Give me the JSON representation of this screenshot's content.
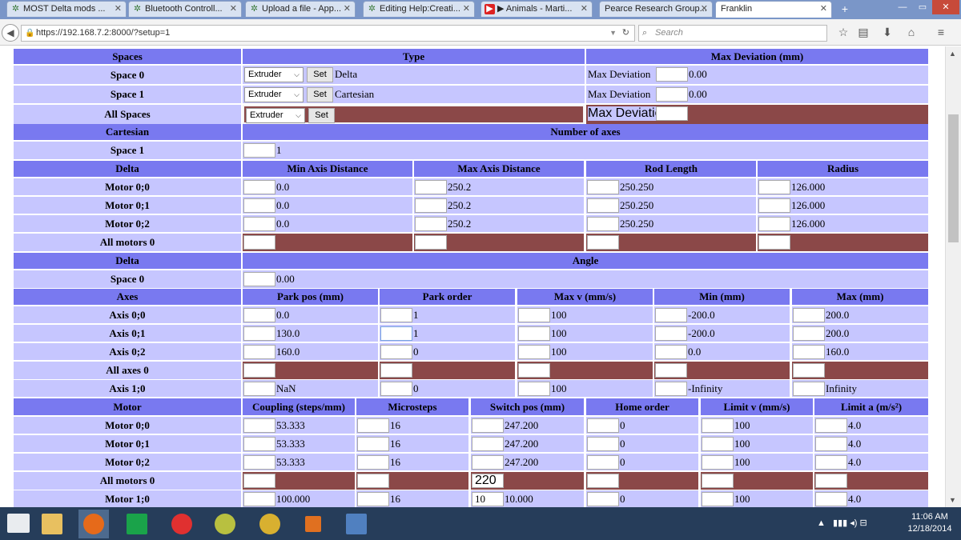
{
  "browser": {
    "tabs": [
      {
        "label": "MOST Delta mods ...",
        "icon": "asterisk-icon"
      },
      {
        "label": "Bluetooth Controll...",
        "icon": "asterisk-icon"
      },
      {
        "label": "Upload a file - App...",
        "icon": "asterisk-icon"
      },
      {
        "label": "Editing Help:Creati...",
        "icon": "asterisk-icon"
      },
      {
        "label": "▶ Animals - Marti...",
        "icon": "youtube-icon"
      },
      {
        "label": "Pearce Research Group...",
        "icon": ""
      },
      {
        "label": "Franklin",
        "icon": ""
      }
    ],
    "url": "https://192.168.7.2:8000/?setup=1",
    "search_placeholder": "Search"
  },
  "spaces": {
    "headers": [
      "Spaces",
      "Type",
      "Max Deviation (mm)"
    ],
    "rows": [
      {
        "label": "Space 0",
        "type": "Extruder",
        "set": "Set",
        "type_value": "Delta",
        "maxdev_label": "Max Deviation",
        "maxdev": "0.00"
      },
      {
        "label": "Space 1",
        "type": "Extruder",
        "set": "Set",
        "type_value": "Cartesian",
        "maxdev_label": "Max Deviation",
        "maxdev": "0.00"
      },
      {
        "label": "All Spaces",
        "type": "Extruder",
        "set": "Set",
        "type_value": "",
        "maxdev_label": "Max Deviation",
        "maxdev": ""
      }
    ]
  },
  "cartesian": {
    "headers": [
      "Cartesian",
      "Number of axes"
    ],
    "rows": [
      {
        "label": "Space 1",
        "value": "1"
      }
    ]
  },
  "delta": {
    "headers": [
      "Delta",
      "Min Axis Distance",
      "Max Axis Distance",
      "Rod Length",
      "Radius"
    ],
    "rows": [
      {
        "label": "Motor 0;0",
        "values": [
          "0.0",
          "250.2",
          "250.250",
          "126.000"
        ]
      },
      {
        "label": "Motor 0;1",
        "values": [
          "0.0",
          "250.2",
          "250.250",
          "126.000"
        ]
      },
      {
        "label": "Motor 0;2",
        "values": [
          "0.0",
          "250.2",
          "250.250",
          "126.000"
        ]
      },
      {
        "label": "All motors 0",
        "values": [
          "",
          "",
          "",
          ""
        ]
      }
    ]
  },
  "delta_angle": {
    "headers": [
      "Delta",
      "Angle"
    ],
    "rows": [
      {
        "label": "Space 0",
        "value": "0.00"
      }
    ]
  },
  "axes": {
    "headers": [
      "Axes",
      "Park pos (mm)",
      "Park order",
      "Max v (mm/s)",
      "Min (mm)",
      "Max (mm)"
    ],
    "rows": [
      {
        "label": "Axis 0;0",
        "values": [
          "0.0",
          "1",
          "100",
          "-200.0",
          "200.0"
        ]
      },
      {
        "label": "Axis 0;1",
        "values": [
          "130.0",
          "1",
          "100",
          "-200.0",
          "200.0"
        ]
      },
      {
        "label": "Axis 0;2",
        "values": [
          "160.0",
          "0",
          "100",
          "0.0",
          "160.0"
        ]
      },
      {
        "label": "All axes 0",
        "values": [
          "",
          "",
          "",
          "",
          ""
        ]
      },
      {
        "label": "Axis 1;0",
        "values": [
          "NaN",
          "0",
          "100",
          "-Infinity",
          "Infinity"
        ]
      }
    ]
  },
  "motor": {
    "headers": [
      "Motor",
      "Coupling (steps/mm)",
      "Microsteps",
      "Switch pos (mm)",
      "Home order",
      "Limit v (mm/s)",
      "Limit a (m/s²)"
    ],
    "rows": [
      {
        "label": "Motor 0;0",
        "values": [
          "53.333",
          "16",
          "247.200",
          "0",
          "100",
          "4.0"
        ]
      },
      {
        "label": "Motor 0;1",
        "values": [
          "53.333",
          "16",
          "247.200",
          "0",
          "100",
          "4.0"
        ]
      },
      {
        "label": "Motor 0;2",
        "values": [
          "53.333",
          "16",
          "247.200",
          "0",
          "100",
          "4.0"
        ]
      },
      {
        "label": "All motors 0",
        "values": [
          "",
          "",
          "",
          "",
          "",
          ""
        ],
        "switch_input": "220"
      },
      {
        "label": "Motor 1;0",
        "values": [
          "100.000",
          "16",
          "10.000",
          "0",
          "100",
          "4.0"
        ],
        "switch_input": "10"
      }
    ]
  },
  "taskbar": {
    "time": "11:06 AM",
    "date": "12/18/2014"
  }
}
